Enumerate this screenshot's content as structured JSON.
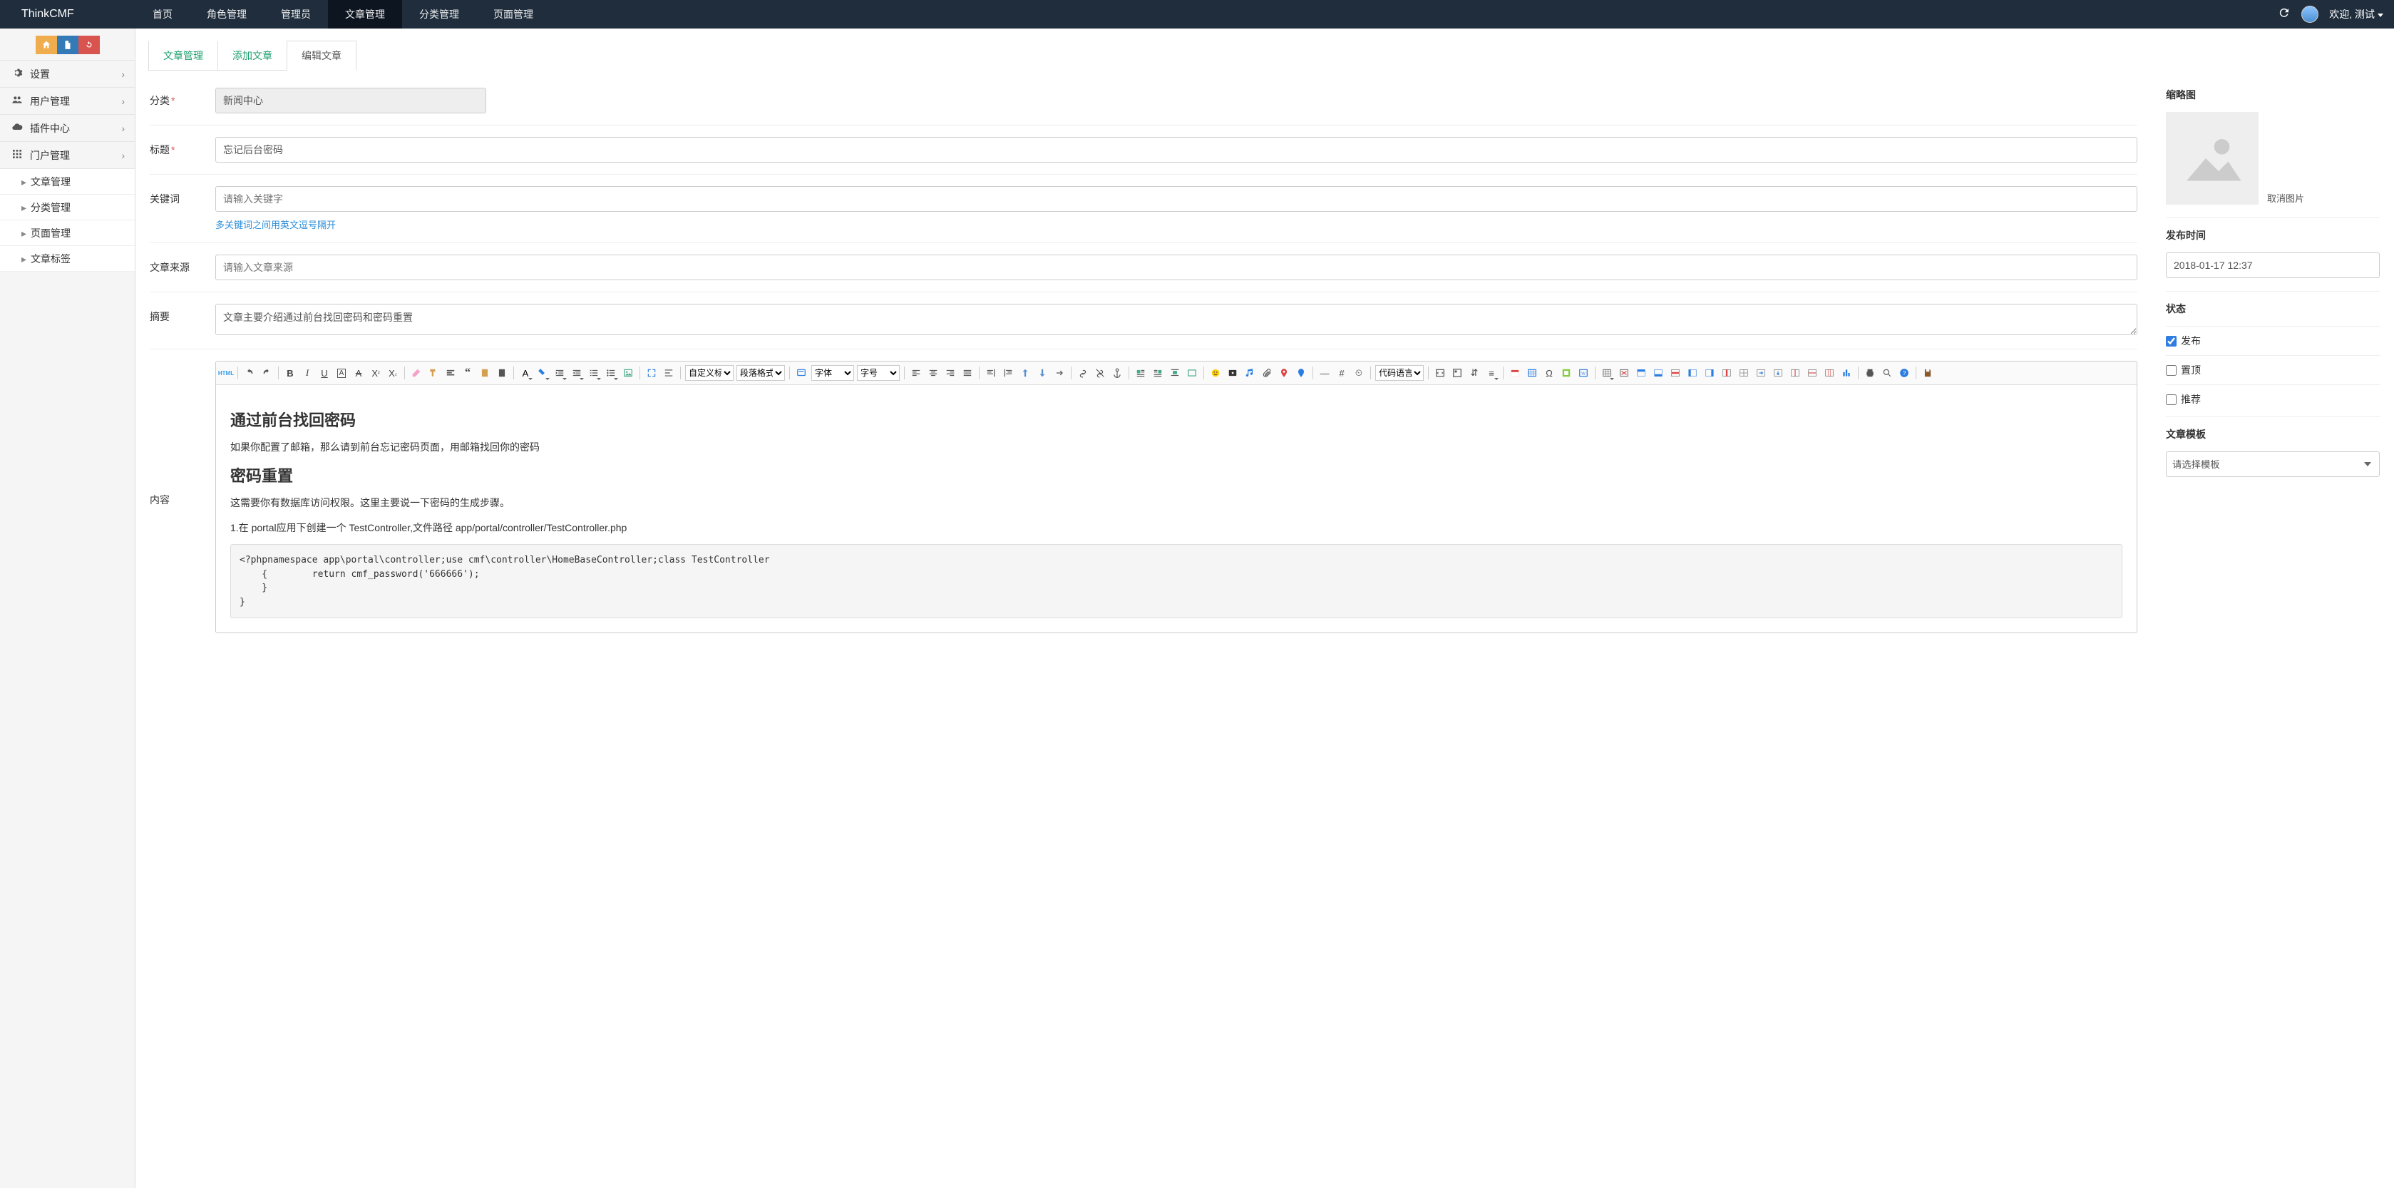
{
  "brand": "ThinkCMF",
  "topMenu": [
    "首页",
    "角色管理",
    "管理员",
    "文章管理",
    "分类管理",
    "页面管理"
  ],
  "topMenuActiveIndex": 3,
  "welcomePrefix": "欢迎, ",
  "welcomeUser": "测试",
  "sidebar": {
    "groups": [
      {
        "icon": "gear",
        "label": "设置"
      },
      {
        "icon": "users",
        "label": "用户管理"
      },
      {
        "icon": "cloud",
        "label": "插件中心"
      },
      {
        "icon": "grid",
        "label": "门户管理",
        "open": true,
        "subs": [
          "文章管理",
          "分类管理",
          "页面管理",
          "文章标签"
        ]
      }
    ]
  },
  "tabs": {
    "items": [
      "文章管理",
      "添加文章",
      "编辑文章"
    ],
    "activeIndex": 2
  },
  "form": {
    "categoryLabel": "分类",
    "categoryValue": "新闻中心",
    "categoryRequired": true,
    "titleLabel": "标题",
    "titleValue": "忘记后台密码",
    "titleRequired": true,
    "keywordsLabel": "关键词",
    "keywordsPlaceholder": "请输入关键字",
    "keywordsHelp": "多关键词之间用英文逗号隔开",
    "sourceLabel": "文章来源",
    "sourcePlaceholder": "请输入文章来源",
    "summaryLabel": "摘要",
    "summaryValue": "文章主要介绍通过前台找回密码和密码重置",
    "contentLabel": "内容",
    "toolbarSelects": {
      "customTitle": "自定义标题",
      "paragraph": "段落格式",
      "font": "字体",
      "size": "字号",
      "codeLang": "代码语言"
    },
    "content": {
      "h1": "通过前台找回密码",
      "p1": "如果你配置了邮箱，那么请到前台忘记密码页面，用邮箱找回你的密码",
      "h2": "密码重置",
      "p2": "这需要你有数据库访问权限。这里主要说一下密码的生成步骤。",
      "p3": "1.在 portal应用下创建一个 TestController,文件路径 app/portal/controller/TestController.php",
      "code": "<?phpnamespace app\\portal\\controller;use cmf\\controller\\HomeBaseController;class TestController \n    {        return cmf_password('666666');\n    }\n}"
    }
  },
  "right": {
    "thumbLabel": "缩略图",
    "cancelImg": "取消图片",
    "publishTimeLabel": "发布时间",
    "publishTime": "2018-01-17 12:37",
    "statusLabel": "状态",
    "publish": "发布",
    "top": "置顶",
    "recommend": "推荐",
    "templateLabel": "文章模板",
    "templatePlaceholder": "请选择模板"
  }
}
